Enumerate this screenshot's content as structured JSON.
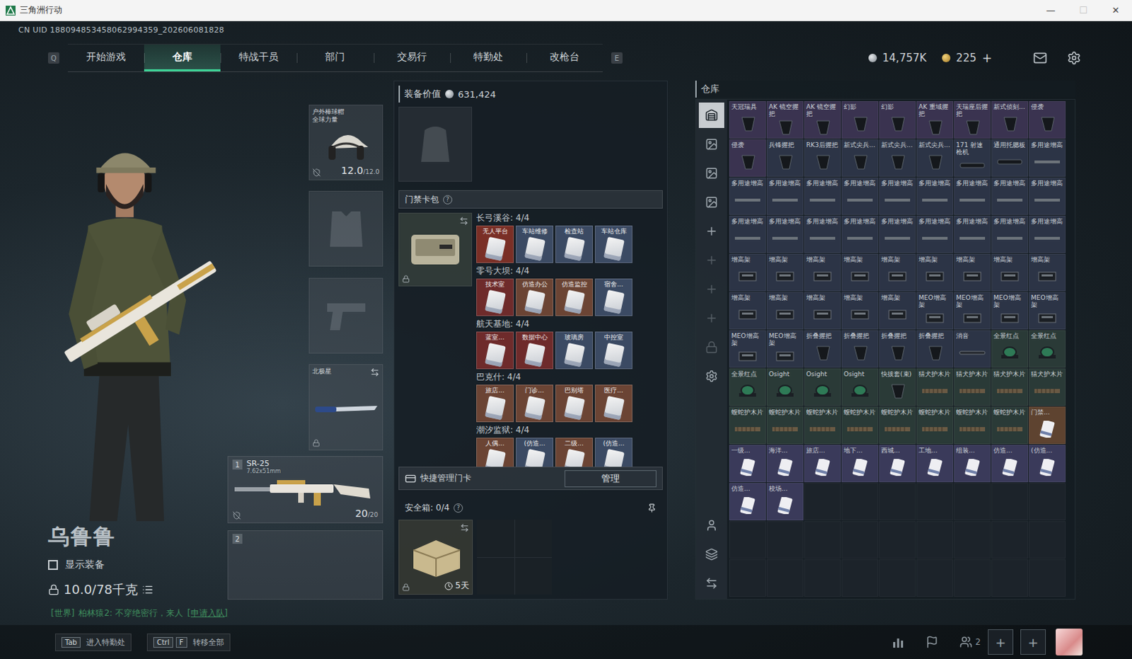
{
  "window": {
    "title": "三角洲行动",
    "controls": [
      {
        "glyph": "—",
        "disabled": false
      },
      {
        "glyph": "☐",
        "disabled": true
      },
      {
        "glyph": "✕",
        "disabled": false
      }
    ]
  },
  "uid": "CN UID 188094853458062994359_202606081828",
  "nav": {
    "prev_key": "Q",
    "next_key": "E",
    "tabs": [
      {
        "label": "开始游戏",
        "selected": false
      },
      {
        "label": "仓库",
        "selected": true
      },
      {
        "label": "特战干员",
        "selected": false
      },
      {
        "label": "部门",
        "selected": false
      },
      {
        "label": "交易行",
        "selected": false
      },
      {
        "label": "特勤处",
        "selected": false
      },
      {
        "label": "改枪台",
        "selected": false
      }
    ]
  },
  "wallet": {
    "coins": "14,757K",
    "tokens": "225",
    "add": "+"
  },
  "character": {
    "name": "乌鲁鲁",
    "show_equipment": {
      "label": "显示装备",
      "checked": false
    },
    "weight": "10.0/78千克"
  },
  "chat": {
    "channel": "[世界]",
    "message": "柏林猿2: 不穿绝密行，来人",
    "action": "[申请入队]"
  },
  "gear": {
    "helmet": {
      "name": "户外棒球帽",
      "brand": "全球力量",
      "durability": "12.0",
      "max": "/12.0"
    },
    "melee": {
      "name": "北极星"
    },
    "weapons": [
      {
        "index": "1",
        "name": "SR-25",
        "caliber": "7.62x51mm",
        "ammo": "20",
        "capacity": "/20"
      },
      {
        "index": "2"
      }
    ]
  },
  "loadout": {
    "label": "装备价值",
    "value": "631,424"
  },
  "keycard_bag": {
    "title": "门禁卡包",
    "help": "?",
    "groups": [
      {
        "map": "长弓溪谷: 4/4",
        "cards": [
          {
            "label": "无人平台",
            "color": "#7a2f26"
          },
          {
            "label": "车站维修",
            "color": "#3b4a63"
          },
          {
            "label": "检查站",
            "color": "#3b4a63"
          },
          {
            "label": "车站仓库",
            "color": "#3b4a63"
          }
        ]
      },
      {
        "map": "零号大坝: 4/4",
        "cards": [
          {
            "label": "技术室",
            "color": "#6e2b2b"
          },
          {
            "label": "仿造办公",
            "color": "#6b4434"
          },
          {
            "label": "仿造监控",
            "color": "#6b4434"
          },
          {
            "label": "宿舍...",
            "color": "#3b4a63"
          }
        ]
      },
      {
        "map": "航天基地: 4/4",
        "cards": [
          {
            "label": "蓝室...",
            "color": "#6e2b2b"
          },
          {
            "label": "数据中心",
            "color": "#6e2b2b"
          },
          {
            "label": "玻璃房",
            "color": "#3b4a63"
          },
          {
            "label": "中控室",
            "color": "#3b4a63"
          }
        ]
      },
      {
        "map": "巴克什: 4/4",
        "cards": [
          {
            "label": "旅店...",
            "color": "#6b4434"
          },
          {
            "label": "门诊...",
            "color": "#6b4434"
          },
          {
            "label": "巴别塔",
            "color": "#6b4434"
          },
          {
            "label": "医疗...",
            "color": "#6b4434"
          }
        ]
      },
      {
        "map": "潮汐监狱: 4/4",
        "cards": [
          {
            "label": "人偶...",
            "color": "#6b4434"
          },
          {
            "label": "(仿造...",
            "color": "#3b4a63"
          },
          {
            "label": "二级...",
            "color": "#6b4434"
          },
          {
            "label": "(仿造...",
            "color": "#3b4a63"
          }
        ]
      }
    ]
  },
  "quick_manage": {
    "label": "快捷管理门卡",
    "button": "管理"
  },
  "safebox": {
    "label": "安全箱: 0/4",
    "help": "?",
    "timer": "5天"
  },
  "warehouse": {
    "title": "仓库",
    "sidebar_top": [
      {
        "kind": "warehouse",
        "selected": true,
        "disabled": false
      },
      {
        "kind": "tab",
        "selected": false,
        "disabled": false
      },
      {
        "kind": "tab",
        "selected": false,
        "disabled": false
      },
      {
        "kind": "tab",
        "selected": false,
        "disabled": false
      },
      {
        "kind": "add",
        "selected": false,
        "disabled": false
      },
      {
        "kind": "add",
        "selected": false,
        "disabled": true
      },
      {
        "kind": "add",
        "selected": false,
        "disabled": true
      },
      {
        "kind": "add",
        "selected": false,
        "disabled": true
      },
      {
        "kind": "lock",
        "selected": false,
        "disabled": true
      },
      {
        "kind": "settings",
        "selected": false,
        "disabled": false
      }
    ],
    "sidebar_bottom": [
      {
        "kind": "profile",
        "selected": false,
        "disabled": false
      },
      {
        "kind": "layers",
        "selected": false,
        "disabled": false
      },
      {
        "kind": "transfer",
        "selected": false,
        "disabled": false
      }
    ],
    "items": [
      {
        "name": "天冠瑞具",
        "kind": "grip",
        "color": "#3a3350"
      },
      {
        "name": "AK 镜空握把",
        "kind": "grip",
        "color": "#3a3350"
      },
      {
        "name": "AK 镜空握把",
        "kind": "grip",
        "color": "#3a3350"
      },
      {
        "name": "幻影",
        "kind": "grip",
        "color": "#3a3350"
      },
      {
        "name": "幻影",
        "kind": "grip",
        "color": "#3a3350"
      },
      {
        "name": "AK 重域握把",
        "kind": "grip",
        "color": "#3a3350"
      },
      {
        "name": "天瑞座后握把",
        "kind": "grip",
        "color": "#3a3350"
      },
      {
        "name": "新式侦刻...",
        "kind": "grip",
        "color": "#3a3350"
      },
      {
        "name": "侵袭",
        "kind": "grip",
        "color": "#3a3350"
      },
      {
        "name": "侵袭",
        "kind": "grip",
        "color": "#3a3350"
      },
      {
        "name": "兵锋握把",
        "kind": "grip",
        "color": "#2c3446"
      },
      {
        "name": "RK3后握把",
        "kind": "grip",
        "color": "#2c3446"
      },
      {
        "name": "新式尖兵...",
        "kind": "grip",
        "color": "#2c3446"
      },
      {
        "name": "新式尖兵...",
        "kind": "grip",
        "color": "#2c3446"
      },
      {
        "name": "新式尖兵...",
        "kind": "grip",
        "color": "#2c3446"
      },
      {
        "name": "171 射速枪机",
        "kind": "stock",
        "color": "#2c3446"
      },
      {
        "name": "通用托腮板",
        "kind": "stock",
        "color": "#2c3446"
      },
      {
        "name": "多用途增高",
        "kind": "rail",
        "color": "#2c3446"
      },
      {
        "name": "多用途增高",
        "kind": "rail",
        "color": "#2c3446"
      },
      {
        "name": "多用途增高",
        "kind": "rail",
        "color": "#2c3446"
      },
      {
        "name": "多用途增高",
        "kind": "rail",
        "color": "#2c3446"
      },
      {
        "name": "多用途增高",
        "kind": "rail",
        "color": "#2c3446"
      },
      {
        "name": "多用途增高",
        "kind": "rail",
        "color": "#2c3446"
      },
      {
        "name": "多用途增高",
        "kind": "rail",
        "color": "#2c3446"
      },
      {
        "name": "多用途增高",
        "kind": "rail",
        "color": "#2c3446"
      },
      {
        "name": "多用途增高",
        "kind": "rail",
        "color": "#2c3446"
      },
      {
        "name": "多用途增高",
        "kind": "rail",
        "color": "#2c3446"
      },
      {
        "name": "多用途增高",
        "kind": "rail",
        "color": "#2c3446"
      },
      {
        "name": "多用途增高",
        "kind": "rail",
        "color": "#2c3446"
      },
      {
        "name": "多用途增高",
        "kind": "rail",
        "color": "#2c3446"
      },
      {
        "name": "多用途增高",
        "kind": "rail",
        "color": "#2c3446"
      },
      {
        "name": "多用途增高",
        "kind": "rail",
        "color": "#2c3446"
      },
      {
        "name": "多用途增高",
        "kind": "rail",
        "color": "#2c3446"
      },
      {
        "name": "多用途增高",
        "kind": "rail",
        "color": "#2c3446"
      },
      {
        "name": "多用途增高",
        "kind": "rail",
        "color": "#2c3446"
      },
      {
        "name": "多用途增高",
        "kind": "rail",
        "color": "#2c3446"
      },
      {
        "name": "增高架",
        "kind": "riser",
        "color": "#2c3446"
      },
      {
        "name": "增高架",
        "kind": "riser",
        "color": "#2c3446"
      },
      {
        "name": "增高架",
        "kind": "riser",
        "color": "#2c3446"
      },
      {
        "name": "增高架",
        "kind": "riser",
        "color": "#2c3446"
      },
      {
        "name": "增高架",
        "kind": "riser",
        "color": "#2c3446"
      },
      {
        "name": "增高架",
        "kind": "riser",
        "color": "#2c3446"
      },
      {
        "name": "增高架",
        "kind": "riser",
        "color": "#2c3446"
      },
      {
        "name": "增高架",
        "kind": "riser",
        "color": "#2c3446"
      },
      {
        "name": "增高架",
        "kind": "riser",
        "color": "#2c3446"
      },
      {
        "name": "增高架",
        "kind": "riser",
        "color": "#2c3446"
      },
      {
        "name": "增高架",
        "kind": "riser",
        "color": "#2c3446"
      },
      {
        "name": "增高架",
        "kind": "riser",
        "color": "#2c3446"
      },
      {
        "name": "增高架",
        "kind": "riser",
        "color": "#2c3446"
      },
      {
        "name": "增高架",
        "kind": "riser",
        "color": "#2c3446"
      },
      {
        "name": "MEO增高架",
        "kind": "riser",
        "color": "#2c3446"
      },
      {
        "name": "MEO增高架",
        "kind": "riser",
        "color": "#2c3446"
      },
      {
        "name": "MEO增高架",
        "kind": "riser",
        "color": "#2c3446"
      },
      {
        "name": "MEO增高架",
        "kind": "riser",
        "color": "#2c3446"
      },
      {
        "name": "MEO增高架",
        "kind": "riser",
        "color": "#2c3446"
      },
      {
        "name": "MEO增高架",
        "kind": "riser",
        "color": "#2c3446"
      },
      {
        "name": "折叠握把",
        "kind": "grip",
        "color": "#2c3446"
      },
      {
        "name": "折叠握把",
        "kind": "grip",
        "color": "#2c3446"
      },
      {
        "name": "折叠握把",
        "kind": "grip",
        "color": "#2c3446"
      },
      {
        "name": "折叠握把",
        "kind": "grip",
        "color": "#2c3446"
      },
      {
        "name": "消音",
        "kind": "suppressor",
        "color": "#2c3446"
      },
      {
        "name": "全景红点",
        "kind": "sight",
        "color": "#2a3a37"
      },
      {
        "name": "全景红点",
        "kind": "sight",
        "color": "#2a3a37"
      },
      {
        "name": "全景红点",
        "kind": "sight",
        "color": "#2a3a37"
      },
      {
        "name": "Osight",
        "kind": "sight",
        "color": "#2a3a37"
      },
      {
        "name": "Osight",
        "kind": "sight",
        "color": "#2a3a37"
      },
      {
        "name": "Osight",
        "kind": "sight",
        "color": "#2a3a37"
      },
      {
        "name": "快拔套(束)",
        "kind": "grip",
        "color": "#2a3a37"
      },
      {
        "name": "猎犬护木片",
        "kind": "handguard",
        "color": "#2a3a37"
      },
      {
        "name": "猎犬护木片",
        "kind": "handguard",
        "color": "#2a3a37"
      },
      {
        "name": "猎犬护木片",
        "kind": "handguard",
        "color": "#2a3a37"
      },
      {
        "name": "猎犬护木片",
        "kind": "handguard",
        "color": "#2a3a37"
      },
      {
        "name": "蝮蛇护木片",
        "kind": "handguard",
        "color": "#2a3a37"
      },
      {
        "name": "蝮蛇护木片",
        "kind": "handguard",
        "color": "#2a3a37"
      },
      {
        "name": "蝮蛇护木片",
        "kind": "handguard",
        "color": "#2a3a37"
      },
      {
        "name": "蝮蛇护木片",
        "kind": "handguard",
        "color": "#2a3a37"
      },
      {
        "name": "蝮蛇护木片",
        "kind": "handguard",
        "color": "#2a3a37"
      },
      {
        "name": "蝮蛇护木片",
        "kind": "handguard",
        "color": "#2a3a37"
      },
      {
        "name": "蝮蛇护木片",
        "kind": "handguard",
        "color": "#2a3a37"
      },
      {
        "name": "蝮蛇护木片",
        "kind": "handguard",
        "color": "#2a3a37"
      },
      {
        "name": "门禁...",
        "kind": "card",
        "color": "#5e4330"
      },
      {
        "name": "一级...",
        "kind": "card",
        "color": "#3a3a5a"
      },
      {
        "name": "海洋...",
        "kind": "card",
        "color": "#3a3a5a"
      },
      {
        "name": "旅店...",
        "kind": "card",
        "color": "#3a3a5a"
      },
      {
        "name": "地下...",
        "kind": "card",
        "color": "#3a3a5a"
      },
      {
        "name": "西城...",
        "kind": "card",
        "color": "#3a3a5a"
      },
      {
        "name": "工地...",
        "kind": "card",
        "color": "#3a3a5a"
      },
      {
        "name": "组装...",
        "kind": "card",
        "color": "#3a3a5a"
      },
      {
        "name": "仿造...",
        "kind": "card",
        "color": "#3a3a5a"
      },
      {
        "name": "(仿造...",
        "kind": "card",
        "color": "#3a3a5a"
      },
      {
        "name": "仿造...",
        "kind": "card",
        "color": "#3a3a5a"
      },
      {
        "name": "校场...",
        "kind": "card",
        "color": "#3a3a5a"
      }
    ]
  },
  "bottom_bar": {
    "hints": [
      {
        "keys": [
          "Tab"
        ],
        "label": "进入特勤处"
      },
      {
        "keys": [
          "Ctrl",
          "F"
        ],
        "label": "转移全部"
      }
    ],
    "friends": "2",
    "party_slots": [
      "+",
      "+"
    ]
  }
}
